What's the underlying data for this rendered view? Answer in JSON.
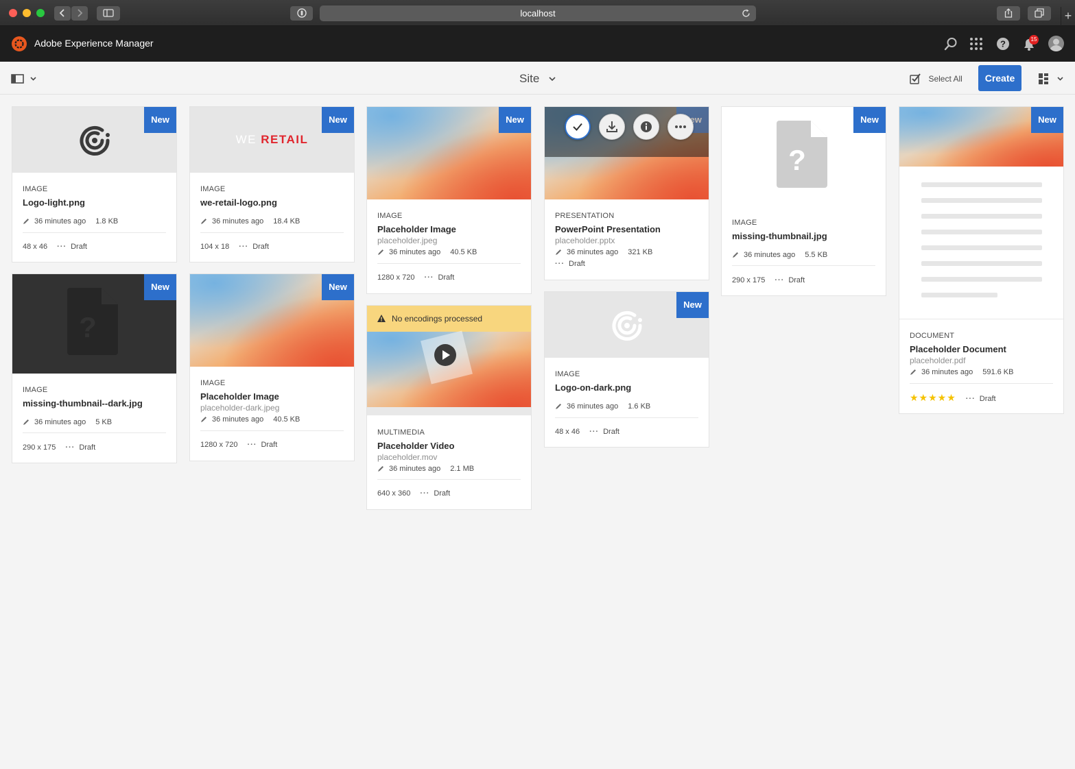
{
  "browser": {
    "url": "localhost"
  },
  "header": {
    "brand": "Adobe Experience Manager",
    "notification_count": "15"
  },
  "toolbar": {
    "site_label": "Site",
    "select_all": "Select All",
    "create": "Create"
  },
  "badge_new": "New",
  "cards": {
    "c1": {
      "type": "IMAGE",
      "title": "Logo-light.png",
      "modified": "36 minutes ago",
      "size": "1.8 KB",
      "dims": "48 x 46",
      "status": "Draft"
    },
    "c2": {
      "type": "IMAGE",
      "title": "we-retail-logo.png",
      "modified": "36 minutes ago",
      "size": "18.4 KB",
      "dims": "104 x 18",
      "status": "Draft",
      "logo_we": "WE",
      "logo_retail": "RETAIL"
    },
    "c3": {
      "type": "IMAGE",
      "title": "Placeholder Image",
      "file": "placeholder.jpeg",
      "modified": "36 minutes ago",
      "size": "40.5 KB",
      "dims": "1280 x 720",
      "status": "Draft"
    },
    "c4": {
      "type": "PRESENTATION",
      "title": "PowerPoint Presentation",
      "file": "placeholder.pptx",
      "modified": "36 minutes ago",
      "size": "321 KB",
      "status": "Draft"
    },
    "c5": {
      "type": "IMAGE",
      "title": "missing-thumbnail.jpg",
      "modified": "36 minutes ago",
      "size": "5.5 KB",
      "dims": "290 x 175",
      "status": "Draft"
    },
    "c6": {
      "type": "DOCUMENT",
      "title": "Placeholder Document",
      "file": "placeholder.pdf",
      "modified": "36 minutes ago",
      "size": "591.6 KB",
      "rating": "★★★★★",
      "status": "Draft"
    },
    "c7": {
      "type": "IMAGE",
      "title": "missing-thumbnail--dark.jpg",
      "modified": "36 minutes ago",
      "size": "5 KB",
      "dims": "290 x 175",
      "status": "Draft"
    },
    "c8": {
      "type": "IMAGE",
      "title": "Placeholder Image",
      "file": "placeholder-dark.jpeg",
      "modified": "36 minutes ago",
      "size": "40.5 KB",
      "dims": "1280 x 720",
      "status": "Draft"
    },
    "c9": {
      "type": "MULTIMEDIA",
      "title": "Placeholder Video",
      "file": "placeholder.mov",
      "modified": "36 minutes ago",
      "size": "2.1 MB",
      "dims": "640 x 360",
      "status": "Draft",
      "warning": "No encodings processed"
    },
    "c10": {
      "type": "IMAGE",
      "title": "Logo-on-dark.png",
      "modified": "36 minutes ago",
      "size": "1.6 KB",
      "dims": "48 x 46",
      "status": "Draft"
    }
  },
  "colors": {
    "accent": "#2d6fcb",
    "header_bg": "#1e1e1e",
    "warning_bg": "#f8d67e",
    "star": "#f5c200",
    "notification": "#e02020"
  }
}
